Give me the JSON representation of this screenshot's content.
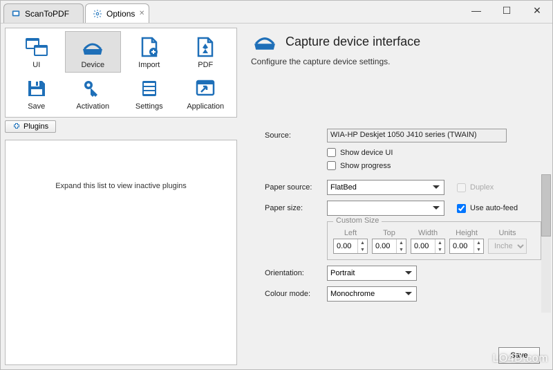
{
  "tabs": [
    {
      "label": "ScanToPDF",
      "icon": "app-icon"
    },
    {
      "label": "Options",
      "icon": "gear-icon"
    }
  ],
  "toolbar": {
    "items": [
      {
        "label": "UI",
        "icon": "ui-icon"
      },
      {
        "label": "Device",
        "icon": "device-icon"
      },
      {
        "label": "Import",
        "icon": "import-icon"
      },
      {
        "label": "PDF",
        "icon": "pdf-icon"
      },
      {
        "label": "Save",
        "icon": "save-icon"
      },
      {
        "label": "Activation",
        "icon": "key-icon"
      },
      {
        "label": "Settings",
        "icon": "settings-icon"
      },
      {
        "label": "Application",
        "icon": "application-icon"
      }
    ],
    "active_index": 1
  },
  "plugins": {
    "tab_label": "Plugins",
    "empty_text": "Expand this list to view inactive plugins"
  },
  "page": {
    "title": "Capture device interface",
    "subtitle": "Configure the capture device settings."
  },
  "form": {
    "source_label": "Source:",
    "source_value": "WIA-HP Deskjet 1050 J410 series (TWAIN)",
    "show_device_ui": {
      "label": "Show device UI",
      "checked": false
    },
    "show_progress": {
      "label": "Show progress",
      "checked": false
    },
    "paper_source_label": "Paper source:",
    "paper_source_value": "FlatBed",
    "duplex": {
      "label": "Duplex",
      "checked": false,
      "enabled": false
    },
    "paper_size_label": "Paper size:",
    "paper_size_value": "",
    "use_auto_feed": {
      "label": "Use auto-feed",
      "checked": true
    },
    "custom_size": {
      "legend": "Custom Size",
      "left_label": "Left",
      "left": "0.00",
      "top_label": "Top",
      "top": "0.00",
      "width_label": "Width",
      "width": "0.00",
      "height_label": "Height",
      "height": "0.00",
      "units_label": "Units",
      "units": "Inches"
    },
    "orientation_label": "Orientation:",
    "orientation_value": "Portrait",
    "colour_mode_label": "Colour mode:",
    "colour_mode_value": "Monochrome"
  },
  "buttons": {
    "save": "Save"
  },
  "watermark": "LO4D.com"
}
